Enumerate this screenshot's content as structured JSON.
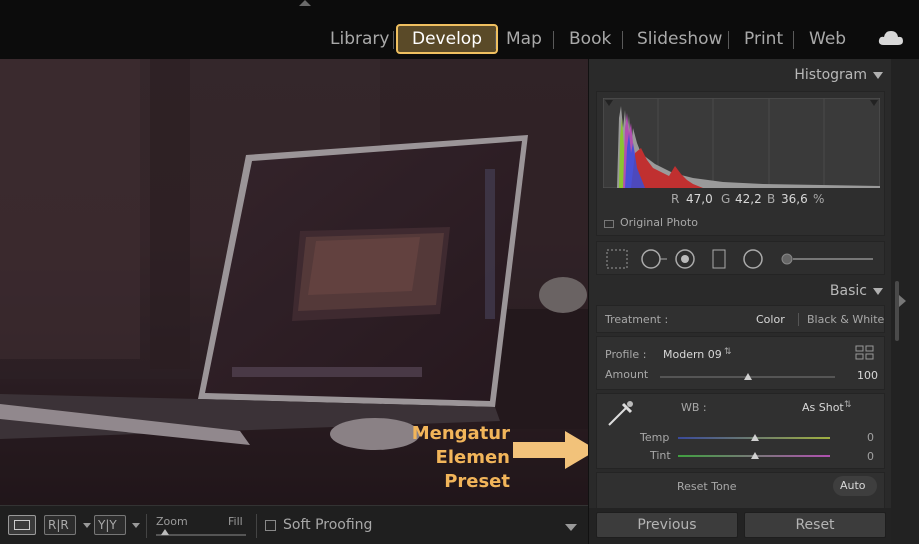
{
  "modules": {
    "items": [
      {
        "label": "Library"
      },
      {
        "label": "Develop",
        "active": true
      },
      {
        "label": "Map"
      },
      {
        "label": "Book"
      },
      {
        "label": "Slideshow"
      },
      {
        "label": "Print"
      },
      {
        "label": "Web"
      }
    ],
    "cloud_icon": "cloud-icon"
  },
  "annotation": {
    "line1": "Mengatur",
    "line2": "Elemen Preset",
    "color": "#f2b55a"
  },
  "toolbar": {
    "view_icon": "loupe-view-icon",
    "before_after_1": "R|R",
    "before_after_2": "Y|Y",
    "zoom_label": "Zoom",
    "zoom_value": "Fill",
    "soft_proofing_label": "Soft Proofing",
    "soft_proofing_checked": false
  },
  "histogram": {
    "title": "Histogram",
    "r_label": "R",
    "r_value": "47,0",
    "g_label": "G",
    "g_value": "42,2",
    "b_label": "B",
    "b_value": "36,6",
    "percent": "%",
    "original_photo_label": "Original Photo",
    "original_photo_checked": false
  },
  "tools": [
    "crop-overlay-icon",
    "spot-removal-icon",
    "red-eye-icon",
    "graduated-filter-icon",
    "radial-filter-icon",
    "adjustment-brush-icon"
  ],
  "basic": {
    "title": "Basic",
    "treatment_label": "Treatment :",
    "treatment_color": "Color",
    "treatment_bw": "Black & White",
    "profile_label": "Profile :",
    "profile_value": "Modern 09",
    "profile_browser_icon": "profile-browser-icon",
    "amount_label": "Amount",
    "amount_value": "100",
    "wb_label": "WB :",
    "wb_value": "As Shot",
    "eyedropper_icon": "eyedropper-icon",
    "temp_label": "Temp",
    "temp_value": "0",
    "tint_label": "Tint",
    "tint_value": "0",
    "reset_tone_label": "Reset Tone",
    "auto_label": "Auto"
  },
  "footer_buttons": {
    "previous": "Previous",
    "reset": "Reset"
  }
}
